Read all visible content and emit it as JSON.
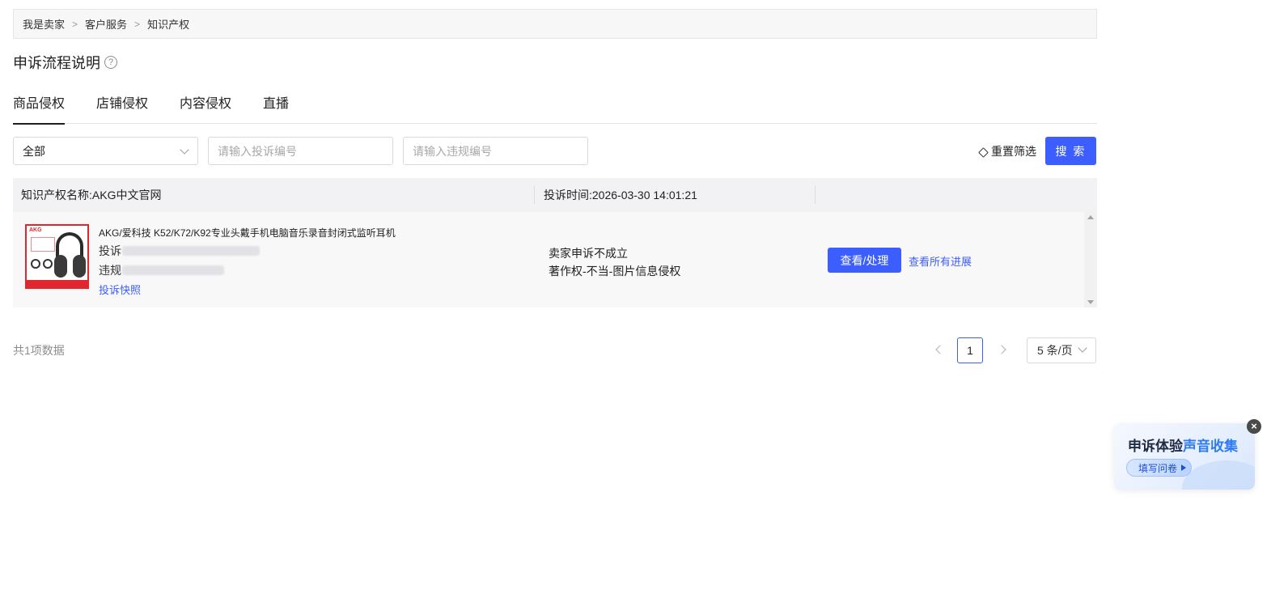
{
  "breadcrumb": {
    "items": [
      "我是卖家",
      "客户服务",
      "知识产权"
    ],
    "separator": ">"
  },
  "page": {
    "title": "申诉流程说明",
    "help_icon": "?"
  },
  "tabs": [
    {
      "label": "商品侵权",
      "active": true
    },
    {
      "label": "店铺侵权",
      "active": false
    },
    {
      "label": "内容侵权",
      "active": false
    },
    {
      "label": "直播",
      "active": false
    }
  ],
  "filters": {
    "type_select": "全部",
    "complaint_no_placeholder": "请输入投诉编号",
    "violation_no_placeholder": "请输入违规编号",
    "reset_label": "重置筛选",
    "search_label": "搜 索"
  },
  "table": {
    "header": {
      "ip_name": "知识产权名称:AKG中文官网",
      "complaint_time": "投诉时间:2026-03-30 14:01:21"
    },
    "row": {
      "product_title": "AKG/爱科技 K52/K72/K92专业头戴手机电脑音乐录音封闭式监听耳机",
      "complaint_label": "投诉",
      "violation_label": "违规",
      "snapshot_link": "投诉快照",
      "status": "卖家申诉不成立",
      "reason": "著作权-不当-图片信息侵权",
      "view_button": "查看/处理",
      "progress_link": "查看所有进展",
      "thumb_brand": "AKG"
    }
  },
  "pagination": {
    "total": "共1项数据",
    "current_page": "1",
    "page_size": "5 条/页"
  },
  "survey": {
    "title_prefix": "申诉体验",
    "title_highlight": "声音收集",
    "button": "填写问卷",
    "close": "×"
  },
  "colors": {
    "primary": "#3c5eff",
    "brand_red": "#e0262f",
    "survey_highlight": "#2f7bf5"
  }
}
